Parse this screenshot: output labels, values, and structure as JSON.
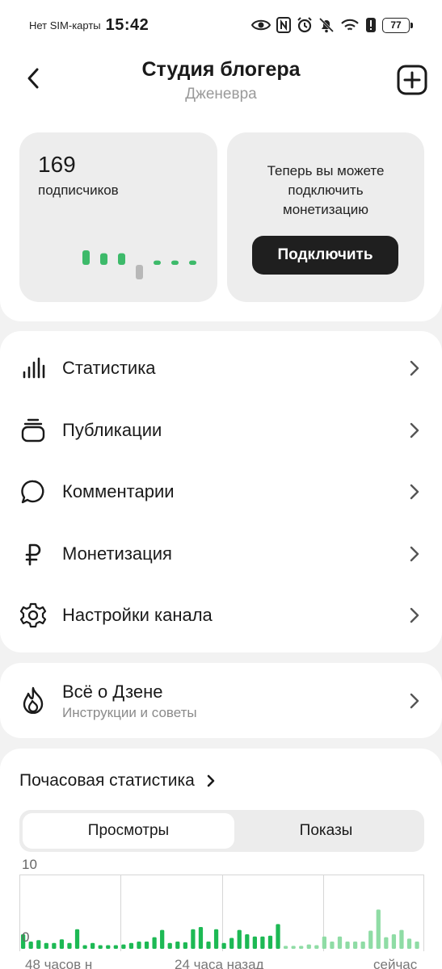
{
  "status_bar": {
    "carrier": "Нет SIM-карты",
    "time": "15:42",
    "battery": "77",
    "icons": [
      "eye-icon",
      "nfc-icon",
      "alarm-icon",
      "bell-off-icon",
      "wifi-icon",
      "alert-icon",
      "battery-icon"
    ]
  },
  "header": {
    "title": "Студия блогера",
    "subtitle": "Дженевра",
    "back_icon": "chevron-left-icon",
    "add_icon": "plus-square-icon"
  },
  "subscribers": {
    "count": "169",
    "label": "подписчиков",
    "trend": [
      {
        "value": 1,
        "color": "#3dba6a"
      },
      {
        "value": 0.8,
        "color": "#3dba6a"
      },
      {
        "value": 0.8,
        "color": "#3dba6a"
      },
      {
        "value": -1,
        "color": "#b8b8b8"
      },
      {
        "value": 0.3,
        "color": "#3dba6a"
      },
      {
        "value": 0.3,
        "color": "#3dba6a"
      },
      {
        "value": 0.3,
        "color": "#3dba6a"
      }
    ]
  },
  "monetization_card": {
    "text": "Теперь вы можете\nподключить\nмонетизацию",
    "button_label": "Подключить"
  },
  "menu": [
    {
      "label": "Статистика",
      "icon": "bar-chart-icon"
    },
    {
      "label": "Публикации",
      "icon": "stack-icon"
    },
    {
      "label": "Комментарии",
      "icon": "comment-icon"
    },
    {
      "label": "Монетизация",
      "icon": "ruble-icon"
    },
    {
      "label": "Настройки канала",
      "icon": "gear-icon"
    }
  ],
  "about": {
    "title": "Всё о Дзене",
    "subtitle": "Инструкции и советы",
    "icon": "flame-icon"
  },
  "hourly_stats": {
    "title": "Почасовая статистика",
    "tabs": [
      "Просмотры",
      "Показы"
    ],
    "active_tab": "Просмотры",
    "colors": {
      "accent": "#1db954",
      "faded": "#8fdca5"
    }
  },
  "chart_data": {
    "type": "bar",
    "ylim": [
      0,
      10
    ],
    "y_ticks": [
      "10",
      "0"
    ],
    "x_tick_labels": [
      "48 часов н",
      "24 часа назад",
      "сейчас"
    ],
    "values": [
      2,
      1,
      1.2,
      0.8,
      0.8,
      1.3,
      0.8,
      2.7,
      0.5,
      0.8,
      0.5,
      0.5,
      0.5,
      0.6,
      0.8,
      1.0,
      1.0,
      1.6,
      2.6,
      0.8,
      1.0,
      0.9,
      2.7,
      3.0,
      1.0,
      2.7,
      0.8,
      1.5,
      2.6,
      2.0,
      1.7,
      1.7,
      1.8,
      3.4,
      0.4,
      0.4,
      0.4,
      0.6,
      0.5,
      1.7,
      1.0,
      1.7,
      1.0,
      1.0,
      1.0,
      2.5,
      5.4,
      1.6,
      2.0,
      2.6,
      1.4,
      1.0
    ],
    "highlight_start": 0,
    "faded_from": 34
  }
}
